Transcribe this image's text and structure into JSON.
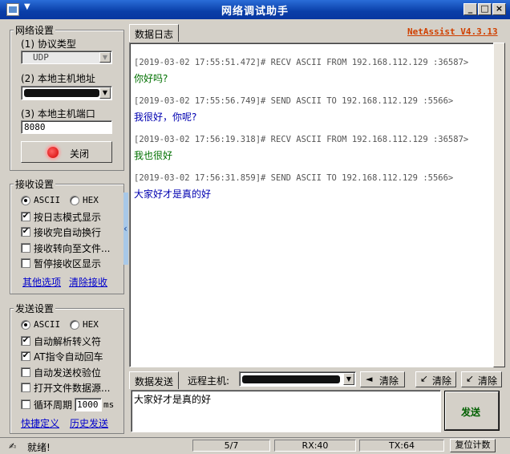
{
  "window": {
    "title": "网络调试助手",
    "brand": "NetAssist V4.3.13",
    "brand_color": "#d04000"
  },
  "network": {
    "group_label": "网络设置",
    "protocol_label": "(1) 协议类型",
    "protocol_value": "UDP",
    "host_label": "(2) 本地主机地址",
    "port_label": "(3) 本地主机端口",
    "port_value": "8080",
    "close_button": "关闭"
  },
  "receive": {
    "group_label": "接收设置",
    "ascii": "ASCII",
    "hex": "HEX",
    "options": [
      {
        "label": "按日志模式显示",
        "checked": true
      },
      {
        "label": "接收完自动换行",
        "checked": true
      },
      {
        "label": "接收转向至文件...",
        "checked": false
      },
      {
        "label": "暂停接收区显示",
        "checked": false
      }
    ],
    "link_other": "其他选项",
    "link_clear": "清除接收"
  },
  "send": {
    "group_label": "发送设置",
    "ascii": "ASCII",
    "hex": "HEX",
    "options": [
      {
        "label": "自动解析转义符",
        "checked": true
      },
      {
        "label": "AT指令自动回车",
        "checked": true
      },
      {
        "label": "自动发送校验位",
        "checked": false
      },
      {
        "label": "打开文件数据源...",
        "checked": false
      }
    ],
    "loop_label": "循环周期",
    "loop_value": "1000",
    "loop_unit": "ms",
    "link_shortcut": "快捷定义",
    "link_history": "历史发送"
  },
  "log": {
    "tab": "数据日志",
    "entries": [
      {
        "head": "[2019-03-02 17:55:51.472]# RECV ASCII FROM 192.168.112.129 :36587>",
        "text": "你好吗?",
        "kind": "recv"
      },
      {
        "head": "[2019-03-02 17:55:56.749]# SEND ASCII TO 192.168.112.129 :5566>",
        "text": "我很好，你呢?",
        "kind": "send"
      },
      {
        "head": "[2019-03-02 17:56:19.318]# RECV ASCII FROM 192.168.112.129 :36587>",
        "text": "我也很好",
        "kind": "recv"
      },
      {
        "head": "[2019-03-02 17:56:31.859]# SEND ASCII TO 192.168.112.129 :5566>",
        "text": "大家好才是真的好",
        "kind": "send"
      }
    ]
  },
  "sendbar": {
    "tab": "数据发送",
    "remote_label": "远程主机:",
    "clear1": "清除",
    "clear2": "清除",
    "clear3": "清除",
    "input_value": "大家好才是真的好",
    "send_button": "发送"
  },
  "status": {
    "ready": "就绪!",
    "count": "5/7",
    "rx": "RX:40",
    "tx": "TX:64",
    "reset": "复位计数"
  }
}
